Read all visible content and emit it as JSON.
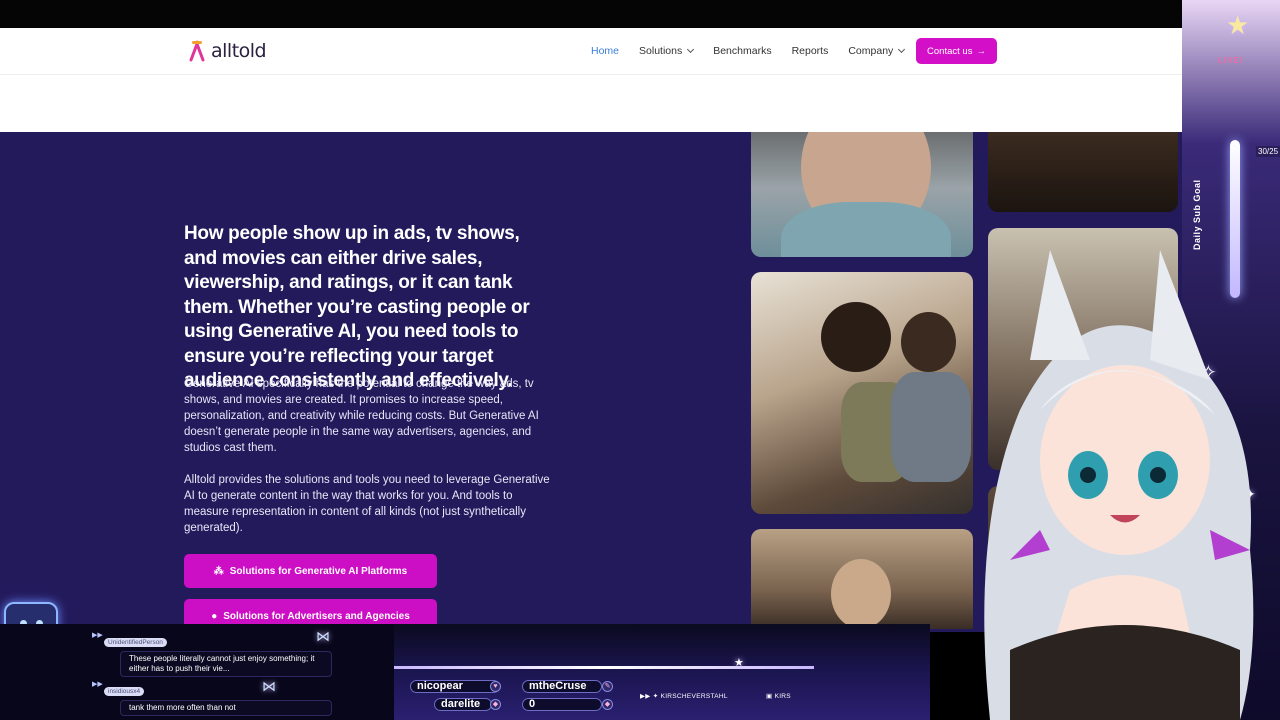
{
  "site": {
    "logo_text": "alltold",
    "nav": {
      "home": "Home",
      "solutions": "Solutions",
      "benchmarks": "Benchmarks",
      "reports": "Reports",
      "company": "Company"
    },
    "contact_label": "Contact us"
  },
  "hero": {
    "headline": "How people show up in ads, tv shows, and movies can either drive sales, viewership, and ratings, or it can tank them. Whether you’re casting people or using Generative AI, you need tools to ensure you’re reflecting your target audience consistently and effectively.",
    "paragraph1": "Generative AI specifically has the potential to change the way ads, tv shows, and movies are created. It promises to increase speed, personalization, and creativity while reducing costs. But Generative AI doesn’t generate people in the same way advertisers, agencies, and studios cast them.",
    "paragraph2": "Alltold provides the solutions and tools you need to leverage Generative AI to generate content in the way that works for you. And tools to measure representation in content of all kinds (not just synthetically generated).",
    "cta_primary": "Solutions for Generative AI Platforms",
    "cta_secondary": "Solutions for Advertisers and Agencies"
  },
  "stream": {
    "live_label": "LIVE!",
    "goal_label": "Daily Sub Goal",
    "goal_count": "30/25",
    "chat": [
      {
        "user": "UnidentifiedPerson",
        "text": "These people literally cannot just enjoy something; it either has to push their vie..."
      },
      {
        "user": "insidiousx4",
        "text": "tank them more often than not"
      }
    ],
    "ticker_names": [
      "nicopear",
      "mtheCruse",
      "darelite",
      "0"
    ],
    "social": [
      "KIRSCHEVERSTAHL",
      "KIRS"
    ]
  },
  "colors": {
    "accent": "#d30fc7",
    "hero_bg": "#231a5c",
    "nav_active": "#3b7fd9"
  }
}
